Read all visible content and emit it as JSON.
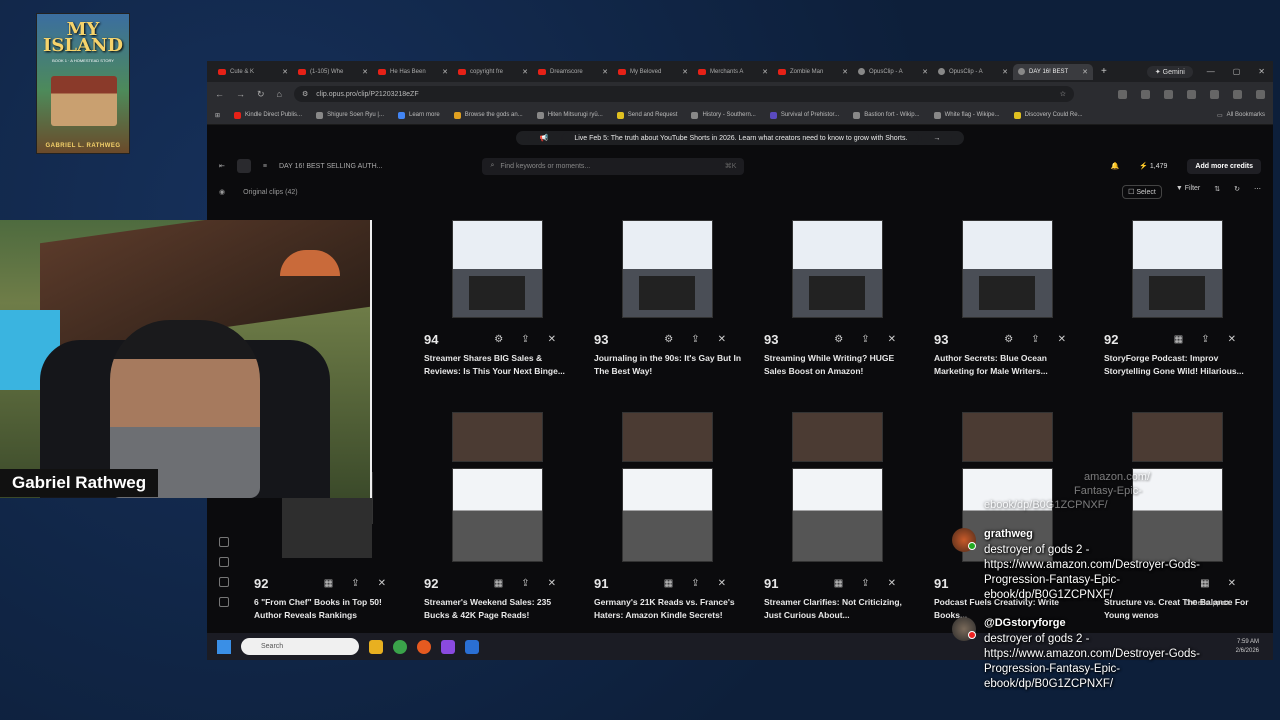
{
  "book": {
    "title_line1": "MY",
    "title_line2": "ISLAND",
    "subtitle": "BOOK 1 · A HOMESTEAD STORY",
    "author": "GABRIEL L. RATHWEG"
  },
  "streamer": {
    "name": "Gabriel Rathweg"
  },
  "browser": {
    "tabs": [
      {
        "label": "Cute & K",
        "type": "yt"
      },
      {
        "label": "(1-105) Whe",
        "type": "yt"
      },
      {
        "label": "He Has Been",
        "type": "yt"
      },
      {
        "label": "copyright fre",
        "type": "yt"
      },
      {
        "label": "Dreamscore",
        "type": "yt"
      },
      {
        "label": "My Beloved",
        "type": "yt"
      },
      {
        "label": "Merchants A",
        "type": "yt"
      },
      {
        "label": "Zombie Man",
        "type": "yt"
      },
      {
        "label": "OpusClip - A",
        "type": "opus"
      },
      {
        "label": "OpusClip - A",
        "type": "opus"
      },
      {
        "label": "DAY 16! BEST",
        "type": "opus",
        "active": true
      }
    ],
    "gemini_label": "Gemini",
    "url": "clip.opus.pro/clip/P21203218eZF",
    "bookmarks": [
      "Kindle Direct Publis...",
      "Shigure Soen Ryu |...",
      "Learn more",
      "Browse the gods an...",
      "Hiten Mitsurugi ryū...",
      "Send and Request",
      "History - Southern...",
      "Survival of Prehistor...",
      "Bastion fort - Wikip...",
      "White flag - Wikipe...",
      "Discovery Could Re..."
    ],
    "all_bookmarks": "All Bookmarks"
  },
  "app": {
    "announcement": "Live Feb 5: The truth about YouTube Shorts in 2026. Learn what creators need to know to grow with Shorts.",
    "project_title": "DAY 16! BEST SELLING AUTH...",
    "search_placeholder": "Find keywords or moments...",
    "search_kbd": "⌘K",
    "credits": "1,479",
    "add_credits": "Add more credits",
    "original_clips": "Original clips",
    "clip_count": "(42)",
    "select_label": "Select",
    "filter_label": "Filter"
  },
  "clips_row1": [
    {
      "score": "",
      "title": "rom"
    },
    {
      "score": "94",
      "title": "Streamer Shares BIG Sales & Reviews: Is This Your Next Binge..."
    },
    {
      "score": "93",
      "title": "Journaling in the 90s: It's Gay But In The Best Way!"
    },
    {
      "score": "93",
      "title": "Streaming While Writing? HUGE Sales Boost on Amazon!"
    },
    {
      "score": "93",
      "title": "Author Secrets: Blue Ocean Marketing for Male Writers..."
    },
    {
      "score": "92",
      "title": "StoryForge Podcast: Improv Storytelling Gone Wild! Hilarious..."
    }
  ],
  "clips_row2": [
    {
      "score": "92",
      "title": "6 \"From Chef\" Books in Top 50! Author Reveals Rankings"
    },
    {
      "score": "92",
      "title": "Streamer's Weekend Sales: 235 Bucks & 42K Page Reads!"
    },
    {
      "score": "91",
      "title": "Germany's 21K Reads vs. France's Haters: Amazon Kindle Secrets!"
    },
    {
      "score": "91",
      "title": "Streamer Clarifies: Not Criticizing, Just Curious About..."
    },
    {
      "score": "91",
      "title": "Podcast Fuels Creativity: Write Books..."
    },
    {
      "score": "",
      "title": "Structure vs. Creat The Balance For Young wenos"
    }
  ],
  "get_support": "Get support",
  "taskbar": {
    "search_placeholder": "Search",
    "time": "7:59 AM",
    "date": "2/6/2026"
  },
  "chat": {
    "faded_line1": "amazon.com/",
    "faded_line2": "Fantasy-Epic-",
    "faded_line3": "ebook/dp/B0G1ZCPNXF/",
    "messages": [
      {
        "user": "grathweg",
        "text": "destroyer of gods 2 - https://www.amazon.com/Destroyer-Gods-Progression-Fantasy-Epic-ebook/dp/B0G1ZCPNXF/"
      },
      {
        "user": "@DGstoryforge",
        "text": "destroyer of gods 2 - https://www.amazon.com/Destroyer-Gods-Progression-Fantasy-Epic-ebook/dp/B0G1ZCPNXF/"
      }
    ]
  }
}
